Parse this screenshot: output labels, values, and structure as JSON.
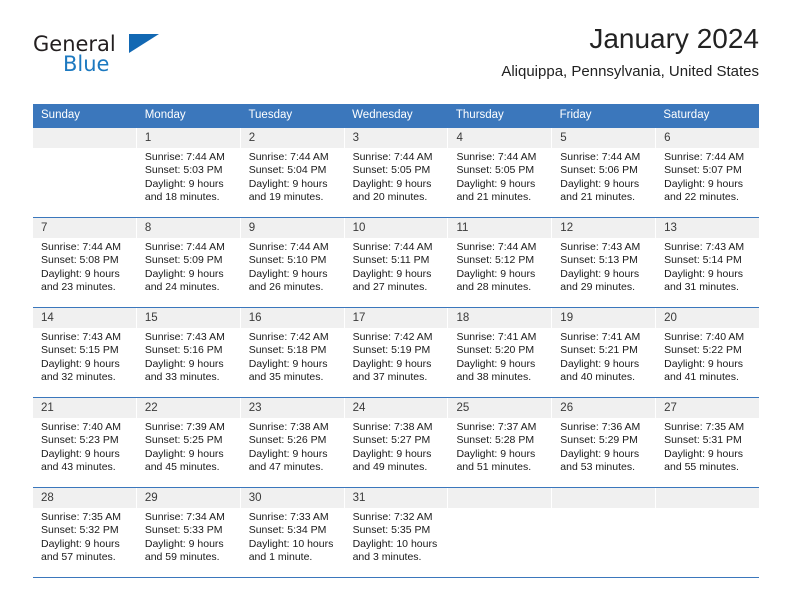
{
  "brand": {
    "name_part1": "General",
    "name_part2": "Blue",
    "triangle_color": "#1268b3",
    "blue_color": "#1c79c0"
  },
  "header": {
    "title": "January 2024",
    "subtitle": "Aliquippa, Pennsylvania, United States"
  },
  "theme": {
    "header_bar": "#3b77bc",
    "daynum_bg": "#f0f0f0",
    "text": "#1a1a1a"
  },
  "weekdays": [
    "Sunday",
    "Monday",
    "Tuesday",
    "Wednesday",
    "Thursday",
    "Friday",
    "Saturday"
  ],
  "labels": {
    "sunrise_prefix": "Sunrise:",
    "sunset_prefix": "Sunset:",
    "daylight_prefix": "Daylight:"
  },
  "weeks": [
    [
      {
        "day": "",
        "empty": true
      },
      {
        "day": "1",
        "sunrise": "Sunrise: 7:44 AM",
        "sunset": "Sunset: 5:03 PM",
        "daylight_line1": "Daylight: 9 hours",
        "daylight_line2": "and 18 minutes."
      },
      {
        "day": "2",
        "sunrise": "Sunrise: 7:44 AM",
        "sunset": "Sunset: 5:04 PM",
        "daylight_line1": "Daylight: 9 hours",
        "daylight_line2": "and 19 minutes."
      },
      {
        "day": "3",
        "sunrise": "Sunrise: 7:44 AM",
        "sunset": "Sunset: 5:05 PM",
        "daylight_line1": "Daylight: 9 hours",
        "daylight_line2": "and 20 minutes."
      },
      {
        "day": "4",
        "sunrise": "Sunrise: 7:44 AM",
        "sunset": "Sunset: 5:05 PM",
        "daylight_line1": "Daylight: 9 hours",
        "daylight_line2": "and 21 minutes."
      },
      {
        "day": "5",
        "sunrise": "Sunrise: 7:44 AM",
        "sunset": "Sunset: 5:06 PM",
        "daylight_line1": "Daylight: 9 hours",
        "daylight_line2": "and 21 minutes."
      },
      {
        "day": "6",
        "sunrise": "Sunrise: 7:44 AM",
        "sunset": "Sunset: 5:07 PM",
        "daylight_line1": "Daylight: 9 hours",
        "daylight_line2": "and 22 minutes."
      }
    ],
    [
      {
        "day": "7",
        "sunrise": "Sunrise: 7:44 AM",
        "sunset": "Sunset: 5:08 PM",
        "daylight_line1": "Daylight: 9 hours",
        "daylight_line2": "and 23 minutes."
      },
      {
        "day": "8",
        "sunrise": "Sunrise: 7:44 AM",
        "sunset": "Sunset: 5:09 PM",
        "daylight_line1": "Daylight: 9 hours",
        "daylight_line2": "and 24 minutes."
      },
      {
        "day": "9",
        "sunrise": "Sunrise: 7:44 AM",
        "sunset": "Sunset: 5:10 PM",
        "daylight_line1": "Daylight: 9 hours",
        "daylight_line2": "and 26 minutes."
      },
      {
        "day": "10",
        "sunrise": "Sunrise: 7:44 AM",
        "sunset": "Sunset: 5:11 PM",
        "daylight_line1": "Daylight: 9 hours",
        "daylight_line2": "and 27 minutes."
      },
      {
        "day": "11",
        "sunrise": "Sunrise: 7:44 AM",
        "sunset": "Sunset: 5:12 PM",
        "daylight_line1": "Daylight: 9 hours",
        "daylight_line2": "and 28 minutes."
      },
      {
        "day": "12",
        "sunrise": "Sunrise: 7:43 AM",
        "sunset": "Sunset: 5:13 PM",
        "daylight_line1": "Daylight: 9 hours",
        "daylight_line2": "and 29 minutes."
      },
      {
        "day": "13",
        "sunrise": "Sunrise: 7:43 AM",
        "sunset": "Sunset: 5:14 PM",
        "daylight_line1": "Daylight: 9 hours",
        "daylight_line2": "and 31 minutes."
      }
    ],
    [
      {
        "day": "14",
        "sunrise": "Sunrise: 7:43 AM",
        "sunset": "Sunset: 5:15 PM",
        "daylight_line1": "Daylight: 9 hours",
        "daylight_line2": "and 32 minutes."
      },
      {
        "day": "15",
        "sunrise": "Sunrise: 7:43 AM",
        "sunset": "Sunset: 5:16 PM",
        "daylight_line1": "Daylight: 9 hours",
        "daylight_line2": "and 33 minutes."
      },
      {
        "day": "16",
        "sunrise": "Sunrise: 7:42 AM",
        "sunset": "Sunset: 5:18 PM",
        "daylight_line1": "Daylight: 9 hours",
        "daylight_line2": "and 35 minutes."
      },
      {
        "day": "17",
        "sunrise": "Sunrise: 7:42 AM",
        "sunset": "Sunset: 5:19 PM",
        "daylight_line1": "Daylight: 9 hours",
        "daylight_line2": "and 37 minutes."
      },
      {
        "day": "18",
        "sunrise": "Sunrise: 7:41 AM",
        "sunset": "Sunset: 5:20 PM",
        "daylight_line1": "Daylight: 9 hours",
        "daylight_line2": "and 38 minutes."
      },
      {
        "day": "19",
        "sunrise": "Sunrise: 7:41 AM",
        "sunset": "Sunset: 5:21 PM",
        "daylight_line1": "Daylight: 9 hours",
        "daylight_line2": "and 40 minutes."
      },
      {
        "day": "20",
        "sunrise": "Sunrise: 7:40 AM",
        "sunset": "Sunset: 5:22 PM",
        "daylight_line1": "Daylight: 9 hours",
        "daylight_line2": "and 41 minutes."
      }
    ],
    [
      {
        "day": "21",
        "sunrise": "Sunrise: 7:40 AM",
        "sunset": "Sunset: 5:23 PM",
        "daylight_line1": "Daylight: 9 hours",
        "daylight_line2": "and 43 minutes."
      },
      {
        "day": "22",
        "sunrise": "Sunrise: 7:39 AM",
        "sunset": "Sunset: 5:25 PM",
        "daylight_line1": "Daylight: 9 hours",
        "daylight_line2": "and 45 minutes."
      },
      {
        "day": "23",
        "sunrise": "Sunrise: 7:38 AM",
        "sunset": "Sunset: 5:26 PM",
        "daylight_line1": "Daylight: 9 hours",
        "daylight_line2": "and 47 minutes."
      },
      {
        "day": "24",
        "sunrise": "Sunrise: 7:38 AM",
        "sunset": "Sunset: 5:27 PM",
        "daylight_line1": "Daylight: 9 hours",
        "daylight_line2": "and 49 minutes."
      },
      {
        "day": "25",
        "sunrise": "Sunrise: 7:37 AM",
        "sunset": "Sunset: 5:28 PM",
        "daylight_line1": "Daylight: 9 hours",
        "daylight_line2": "and 51 minutes."
      },
      {
        "day": "26",
        "sunrise": "Sunrise: 7:36 AM",
        "sunset": "Sunset: 5:29 PM",
        "daylight_line1": "Daylight: 9 hours",
        "daylight_line2": "and 53 minutes."
      },
      {
        "day": "27",
        "sunrise": "Sunrise: 7:35 AM",
        "sunset": "Sunset: 5:31 PM",
        "daylight_line1": "Daylight: 9 hours",
        "daylight_line2": "and 55 minutes."
      }
    ],
    [
      {
        "day": "28",
        "sunrise": "Sunrise: 7:35 AM",
        "sunset": "Sunset: 5:32 PM",
        "daylight_line1": "Daylight: 9 hours",
        "daylight_line2": "and 57 minutes."
      },
      {
        "day": "29",
        "sunrise": "Sunrise: 7:34 AM",
        "sunset": "Sunset: 5:33 PM",
        "daylight_line1": "Daylight: 9 hours",
        "daylight_line2": "and 59 minutes."
      },
      {
        "day": "30",
        "sunrise": "Sunrise: 7:33 AM",
        "sunset": "Sunset: 5:34 PM",
        "daylight_line1": "Daylight: 10 hours",
        "daylight_line2": "and 1 minute."
      },
      {
        "day": "31",
        "sunrise": "Sunrise: 7:32 AM",
        "sunset": "Sunset: 5:35 PM",
        "daylight_line1": "Daylight: 10 hours",
        "daylight_line2": "and 3 minutes."
      },
      {
        "day": "",
        "empty": true
      },
      {
        "day": "",
        "empty": true
      },
      {
        "day": "",
        "empty": true
      }
    ]
  ]
}
